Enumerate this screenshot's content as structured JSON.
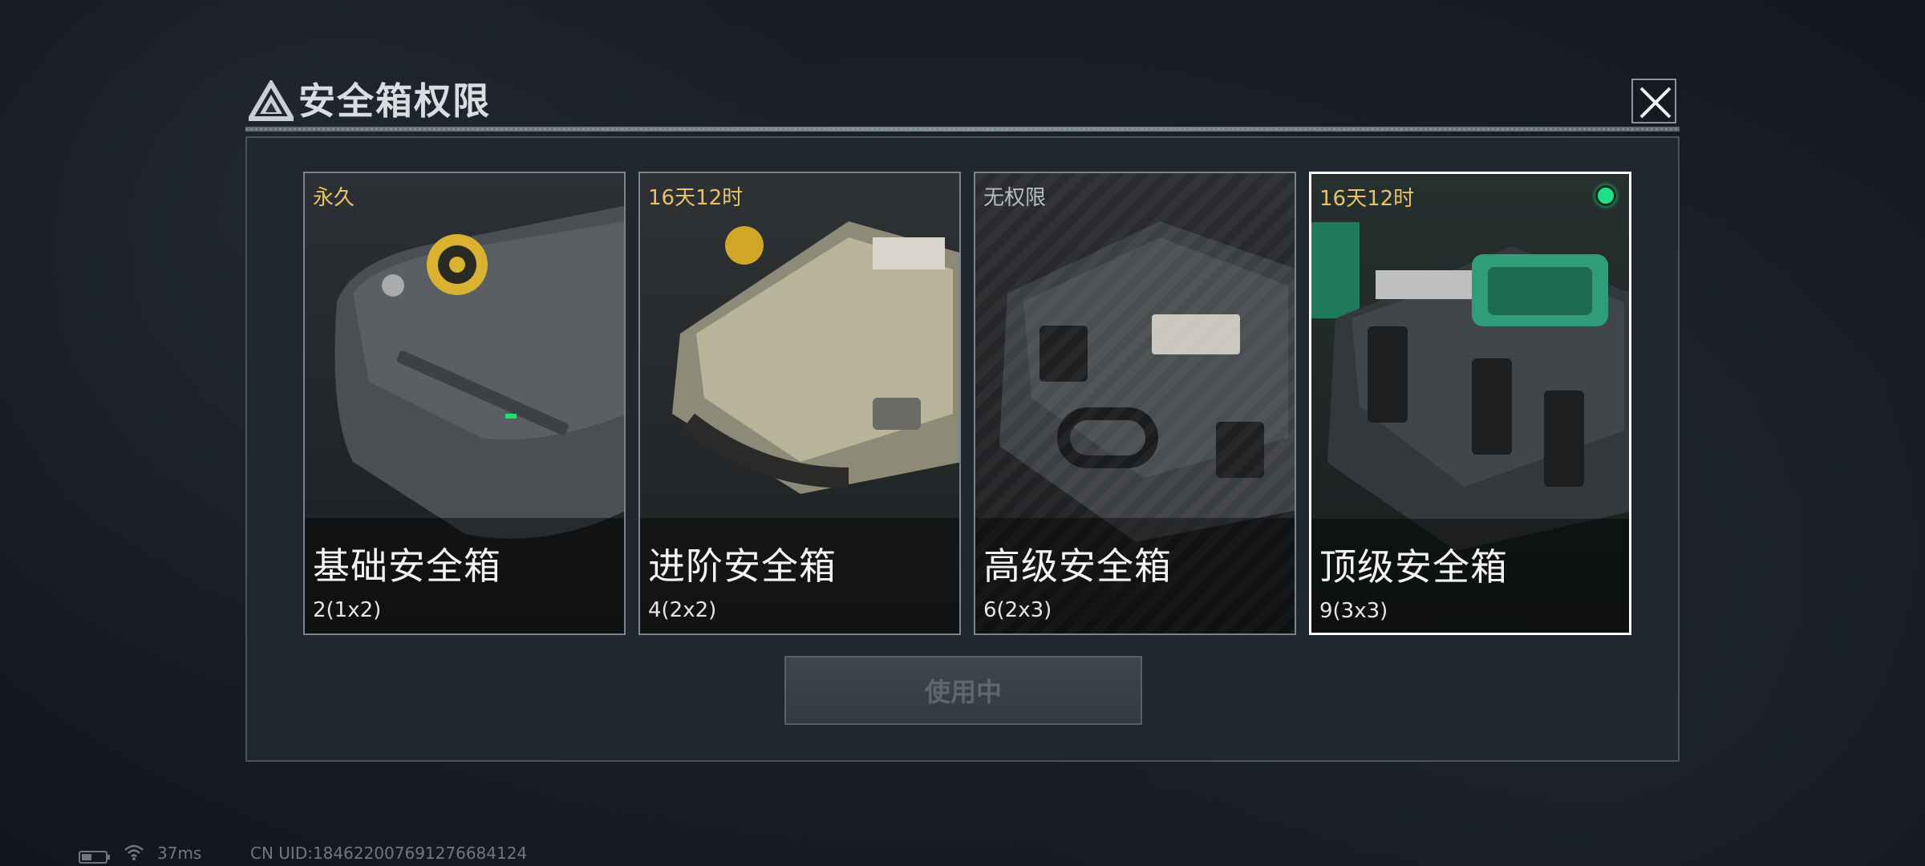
{
  "dialog": {
    "title": "安全箱权限",
    "close_icon": "close-icon",
    "logo_icon": "triangle-logo-icon"
  },
  "cards": [
    {
      "status": "永久",
      "name": "基础安全箱",
      "capacity": "2(1x2)",
      "selected": false
    },
    {
      "status": "16天12时",
      "name": "进阶安全箱",
      "capacity": "4(2x2)",
      "selected": false
    },
    {
      "status": "无权限",
      "name": "高级安全箱",
      "capacity": "6(2x3)",
      "selected": false
    },
    {
      "status": "16天12时",
      "name": "顶级安全箱",
      "capacity": "9(3x3)",
      "selected": true
    }
  ],
  "action_button": {
    "label": "使用中",
    "enabled": false
  },
  "status_bar": {
    "ping": "37ms",
    "uid": "CN UID:1846220076912766841​24"
  },
  "colors": {
    "status_time": "#e7c26a",
    "active_indicator": "#1fe08a",
    "panel_bg": "#222830"
  }
}
